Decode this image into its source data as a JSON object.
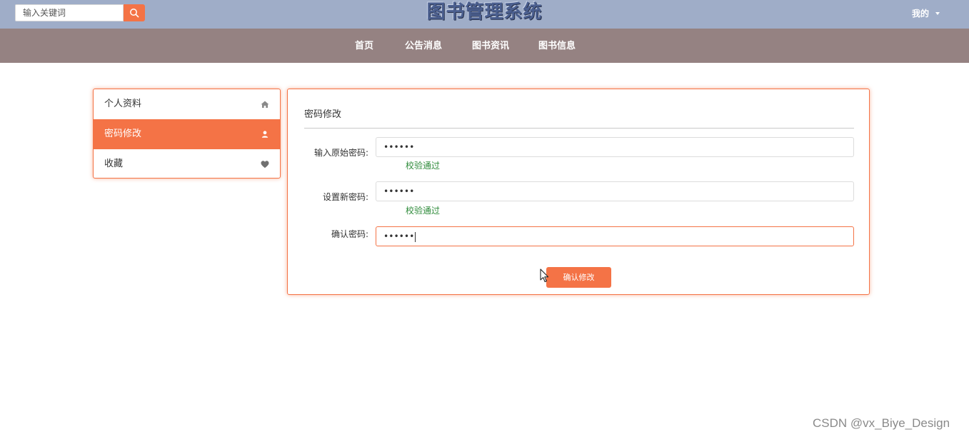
{
  "header": {
    "search_placeholder": "输入关键词",
    "site_title": "图书管理系统",
    "user_menu_label": "我的"
  },
  "nav": {
    "items": [
      {
        "label": "首页"
      },
      {
        "label": "公告消息"
      },
      {
        "label": "图书资讯"
      },
      {
        "label": "图书信息"
      }
    ]
  },
  "sidebar": {
    "items": [
      {
        "label": "个人资料",
        "icon": "home-icon",
        "active": false
      },
      {
        "label": "密码修改",
        "icon": "user-icon",
        "active": true
      },
      {
        "label": "收藏",
        "icon": "heart-icon",
        "active": false
      }
    ]
  },
  "form": {
    "title": "密码修改",
    "fields": [
      {
        "label": "输入原始密码:",
        "value": "••••••",
        "validation": "校验通过"
      },
      {
        "label": "设置新密码:",
        "value": "••••••",
        "validation": "校验通过"
      },
      {
        "label": "确认密码:",
        "value": "••••••",
        "validation": ""
      }
    ],
    "submit_label": "确认修改"
  },
  "watermark": "CSDN @vx_Biye_Design",
  "colors": {
    "accent": "#f47346",
    "topbar": "#9fadc8",
    "navbar": "#958282",
    "valid": "#2e8b3a"
  }
}
